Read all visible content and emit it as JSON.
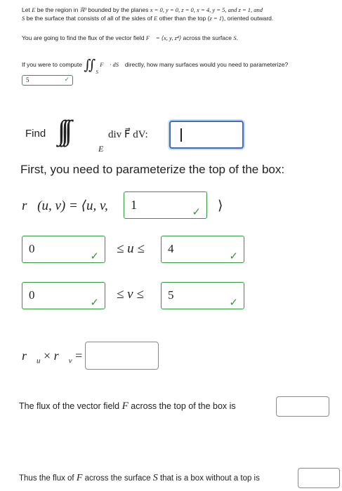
{
  "intro": {
    "line1_prefix": "Let ",
    "line1_E": "E",
    "line1_mid": " be the region in ",
    "line1_R3": "ℝ³",
    "line1_mid2": " bounded by the planes ",
    "line1_planes": "x = 0, y = 0, z = 0, x = 4, y = 5, and z = 1, and",
    "line2_S": "S",
    "line2_a": " be the surface that consists of all of the sides of ",
    "line2_E": "E",
    "line2_b": " other than the top (",
    "line2_z": "z = 1",
    "line2_c": "), oriented outward."
  },
  "flux_intro": {
    "text_a": "You are going to find the flux of the vector field ",
    "F": "F⃗",
    "eq": " = ⟨x, y, z⁴⟩",
    "text_b": " across the surface ",
    "S": "S",
    "dot": "."
  },
  "question1": {
    "text_a": "If you were to compute ",
    "integrand": "F⃗ · dS⃗",
    "sub": "S",
    "text_b": " directly, how many surfaces would you need to parameterize?",
    "answer": "5"
  },
  "find_row": {
    "label": "Find",
    "integrand": "div F⃗ dV:",
    "sub": "E",
    "input_value": ""
  },
  "first_line": "First, you need to parameterize the top of the box:",
  "param": {
    "lhs": "r⃗(u, v) = ⟨u, v,",
    "third_value": "1",
    "close": "⟩"
  },
  "u_bounds": {
    "lower": "0",
    "rel": "≤ u ≤",
    "upper": "4"
  },
  "v_bounds": {
    "lower": "0",
    "rel": "≤ v ≤",
    "upper": "5"
  },
  "cross": {
    "lhs": "r⃗",
    "u": "u",
    "times": "×",
    "v": "v",
    "eq": "=",
    "value": ""
  },
  "flux_top": {
    "text_a": "The flux of the vector field ",
    "F": "F",
    "text_b": " across the top of the box is",
    "value": ""
  },
  "flux_total": {
    "text_a": "Thus the flux of ",
    "F": "F",
    "text_b": " across the surface ",
    "S": "S",
    "text_c": " that is a box without a top is",
    "value": ""
  },
  "colors": {
    "correct": "#2e9a3c",
    "neutral_border": "#8a8a8a",
    "focus_border": "#3f6fb0"
  },
  "icons": {
    "check": "check-icon",
    "chevron": "chevron-down-icon"
  }
}
